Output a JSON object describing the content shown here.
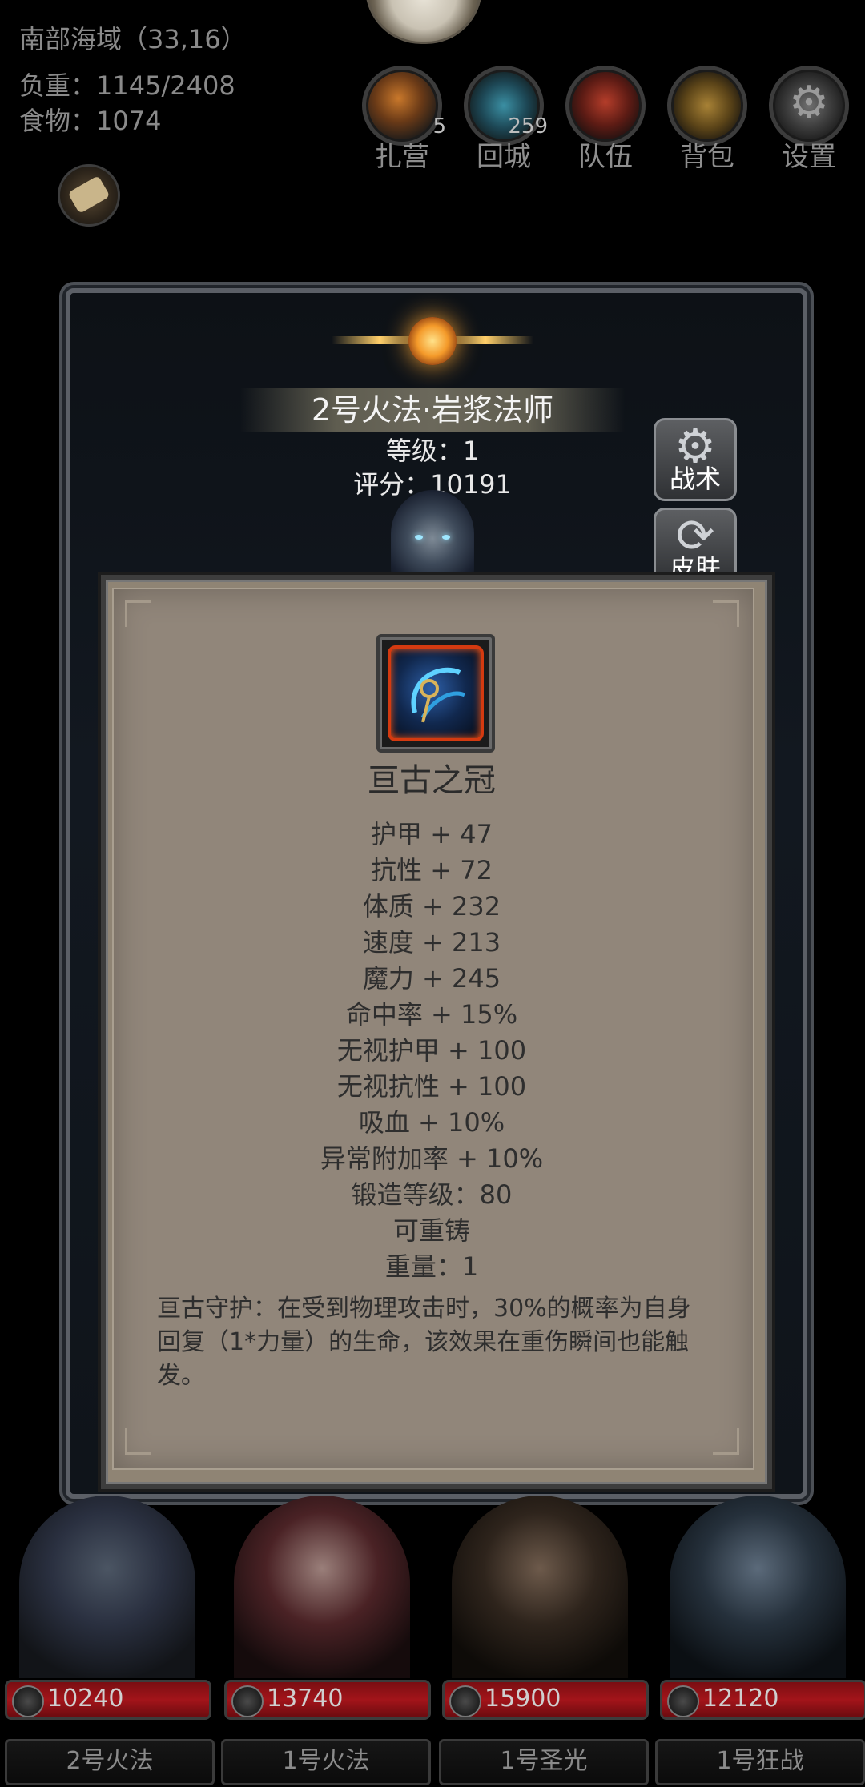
{
  "hud": {
    "location": "南部海域（33,16）",
    "weight_label": "负重：",
    "weight_value": "1145/2408",
    "food_label": "食物：",
    "food_value": "1074",
    "buttons": [
      {
        "label": "扎营",
        "count": "5",
        "icon": "campfire-icon"
      },
      {
        "label": "回城",
        "count": "259",
        "icon": "portal-icon"
      },
      {
        "label": "队伍",
        "count": "",
        "icon": "banner-icon"
      },
      {
        "label": "背包",
        "count": "",
        "icon": "chest-icon"
      },
      {
        "label": "设置",
        "count": "",
        "icon": "gear-icon"
      }
    ],
    "scroll_icon": "scroll-icon"
  },
  "hero": {
    "name": "2号火法·岩浆法师",
    "level": "等级：1",
    "score": "评分：10191",
    "tactics_label": "战术",
    "skin_label": "皮肤"
  },
  "item": {
    "name": "亘古之冠",
    "icon": "crown-icon",
    "stats": [
      "护甲 + 47",
      "抗性 + 72",
      "体质 + 232",
      "速度 + 213",
      "魔力 + 245",
      "命中率 + 15%",
      "无视护甲 + 100",
      "无视抗性 + 100",
      "吸血 + 10%",
      "异常附加率 + 10%",
      "锻造等级：80",
      "可重铸",
      "重量：1"
    ],
    "description": "亘古守护：在受到物理攻击时，30%的概率为自身回复（1*力量）的生命，该效果在重伤瞬间也能触发。"
  },
  "party": [
    {
      "power": "10240",
      "name": "2号火法"
    },
    {
      "power": "13740",
      "name": "1号火法"
    },
    {
      "power": "15900",
      "name": "1号圣光"
    },
    {
      "power": "12120",
      "name": "1号狂战"
    }
  ]
}
